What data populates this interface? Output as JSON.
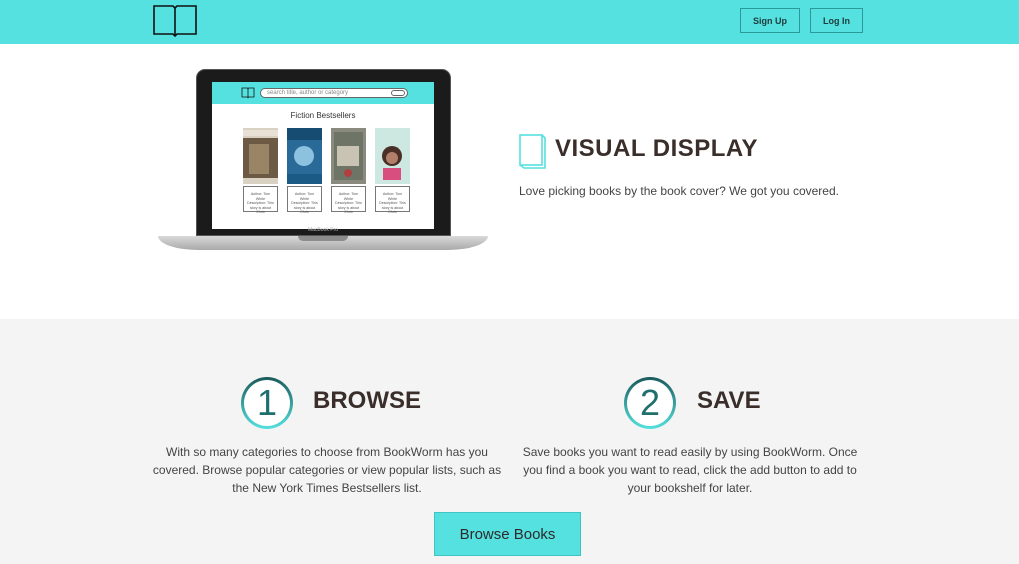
{
  "header": {
    "signup_label": "Sign Up",
    "login_label": "Log In",
    "accent_color": "#55e1df"
  },
  "laptop": {
    "search_placeholder": "search title, author or category",
    "list_title": "Fiction Bestsellers",
    "device_label": "MacBook Pro",
    "book_desc": "Author: Tom White Description: This story is about Chris"
  },
  "visual_display": {
    "icon": "book-icon",
    "title": "VISUAL DISPLAY",
    "text": "Love picking books by the book cover? We got you covered."
  },
  "features": [
    {
      "number": "1",
      "title": "BROWSE",
      "text": "With so many categories to choose from BookWorm has you covered. Browse popular categories or view popular lists, such as the New York Times Bestsellers list."
    },
    {
      "number": "2",
      "title": "SAVE",
      "text": "Save books you want to read easily by using BookWorm. Once you find a book you want to read, click the add button to add to your bookshelf for later."
    }
  ],
  "cta": {
    "browse_label": "Browse Books"
  }
}
